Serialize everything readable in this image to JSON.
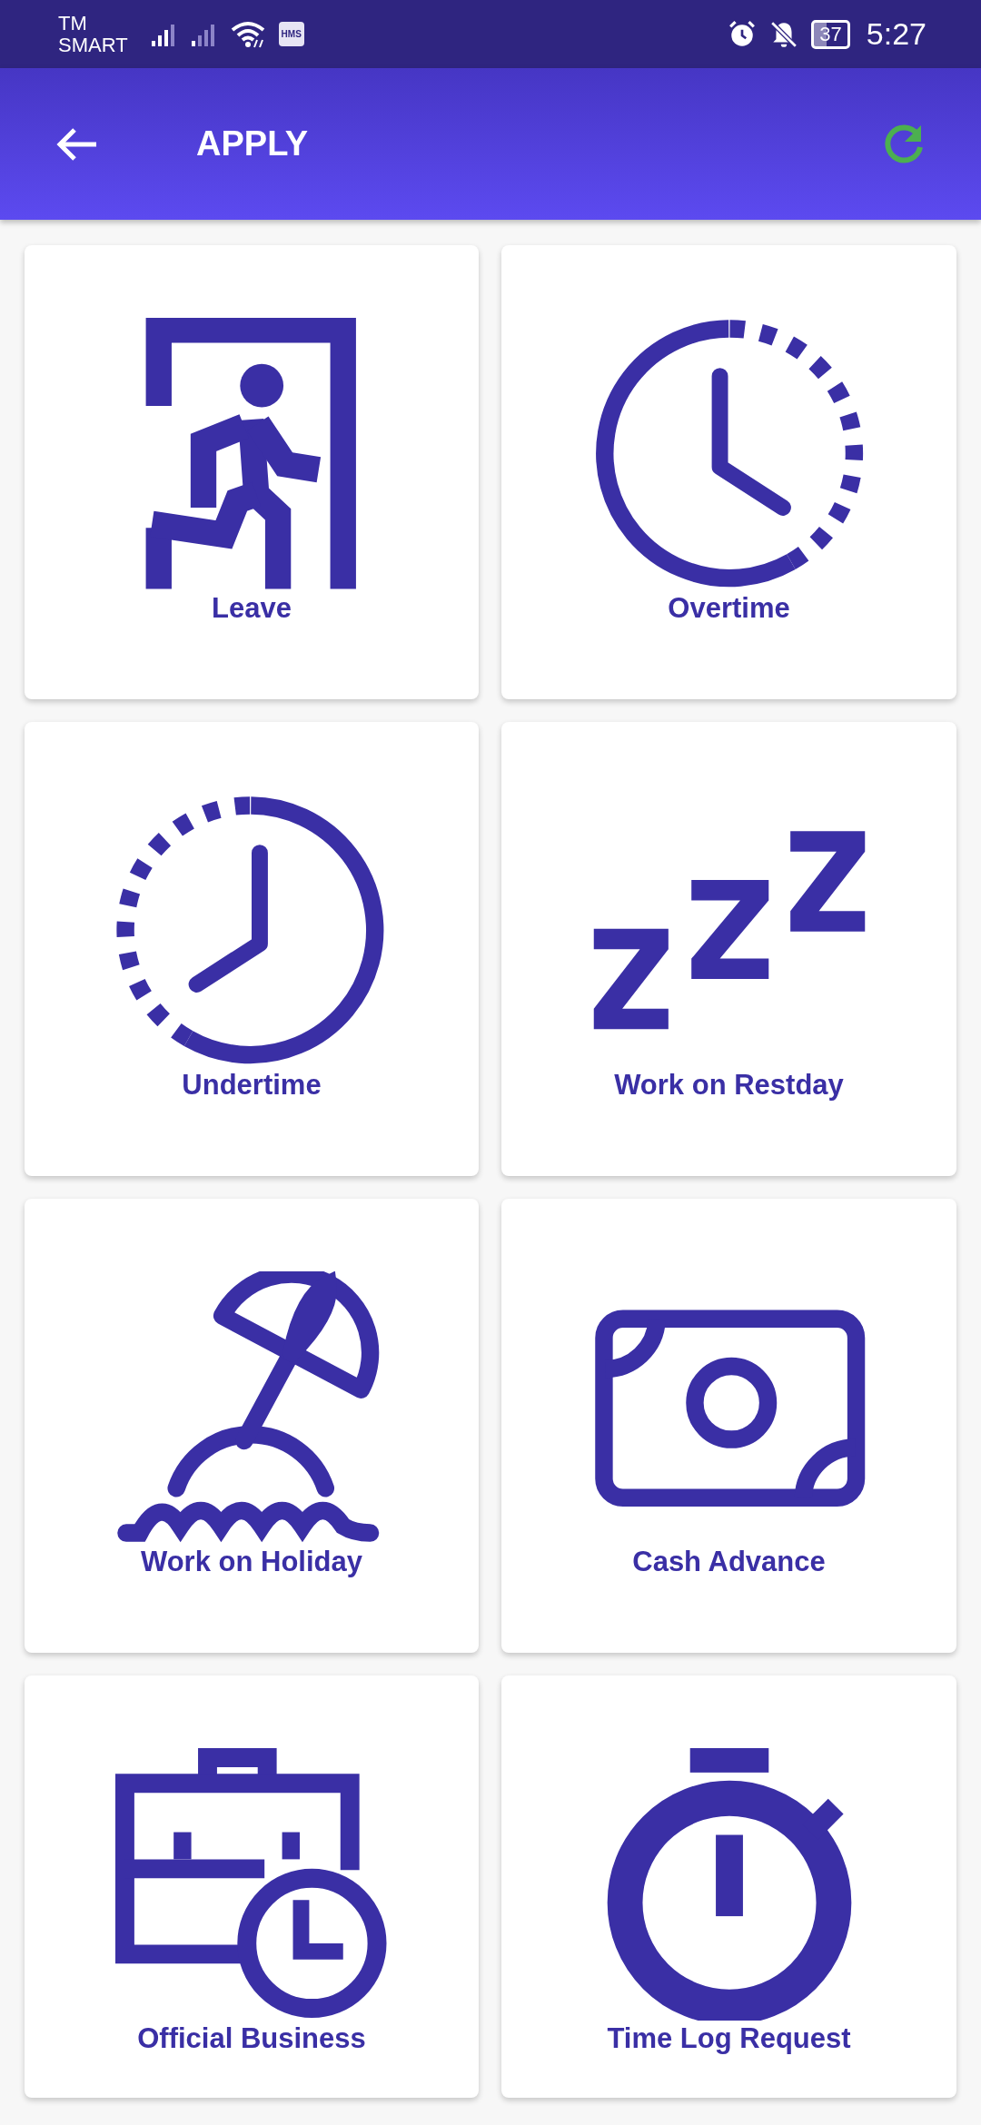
{
  "status_bar": {
    "carrier_lines": [
      "TM",
      "SMART"
    ],
    "badge": "HMS",
    "battery": "37",
    "time": "5:27"
  },
  "header": {
    "title": "APPLY"
  },
  "tiles": [
    {
      "kind": "leave",
      "label": "Leave"
    },
    {
      "kind": "overtime",
      "label": "Overtime"
    },
    {
      "kind": "undertime",
      "label": "Undertime"
    },
    {
      "kind": "restday",
      "label": "Work on Restday"
    },
    {
      "kind": "holiday",
      "label": "Work on Holiday"
    },
    {
      "kind": "cash",
      "label": "Cash Advance"
    },
    {
      "kind": "business",
      "label": "Official Business"
    },
    {
      "kind": "timelog",
      "label": "Time Log Request"
    }
  ]
}
